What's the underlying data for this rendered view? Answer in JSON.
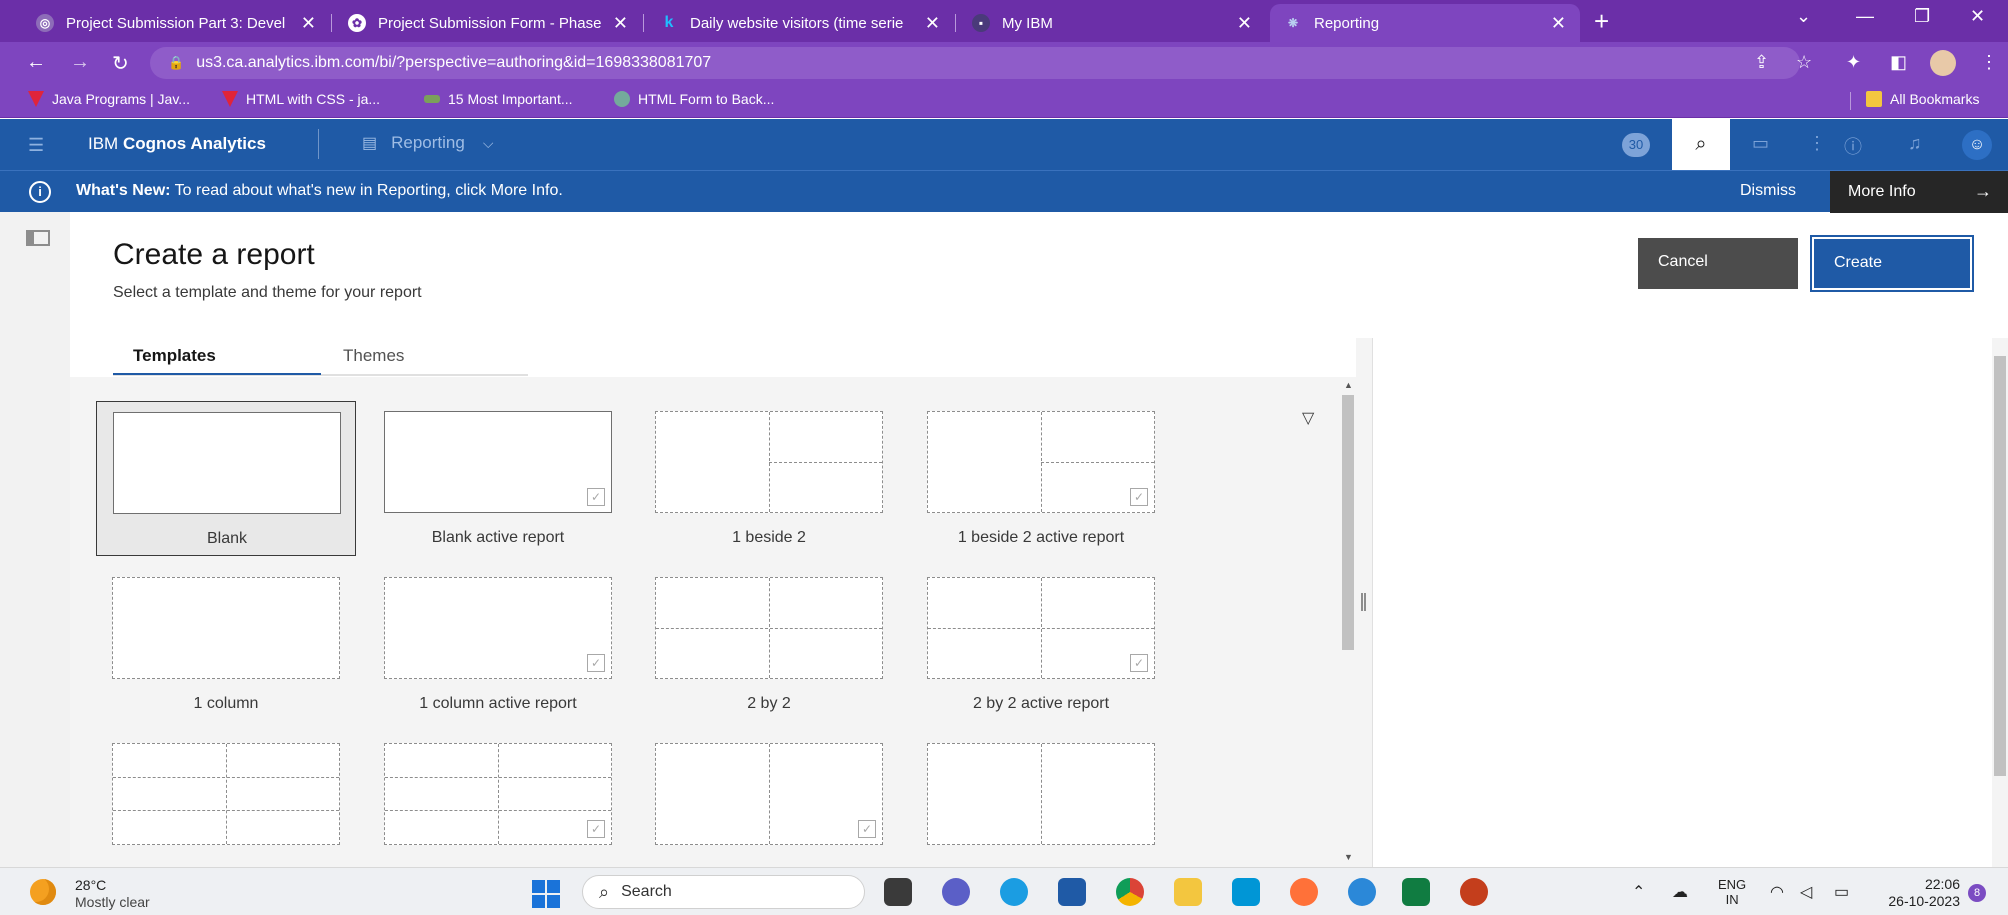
{
  "browser": {
    "tabs": [
      {
        "title": "Project Submission Part 3: Devel",
        "active": false
      },
      {
        "title": "Project Submission Form - Phase",
        "active": false
      },
      {
        "title": "Daily website visitors (time serie",
        "active": false
      },
      {
        "title": "My IBM",
        "active": false
      },
      {
        "title": "Reporting",
        "active": true
      }
    ],
    "url": "us3.ca.analytics.ibm.com/bi/?perspective=authoring&id=1698338081707",
    "bookmarks": [
      "Java Programs | Jav...",
      "HTML with CSS - ja...",
      "15 Most Important...",
      "HTML Form to Back..."
    ],
    "all_bookmarks": "All Bookmarks"
  },
  "app": {
    "brand_prefix": "IBM",
    "brand_name": "Cognos Analytics",
    "perspective": "Reporting",
    "notification_count": "30"
  },
  "whats_new": {
    "label": "What's New:",
    "message": "To read about what's new in Reporting, click More Info.",
    "dismiss": "Dismiss",
    "more_info": "More Info"
  },
  "page": {
    "title": "Create a report",
    "subtitle": "Select a template and theme for your report",
    "cancel": "Cancel",
    "create": "Create",
    "tabs": [
      "Templates",
      "Themes"
    ],
    "selected_tab": "Templates"
  },
  "templates": [
    {
      "label": "Blank",
      "layout": "blank",
      "active": false,
      "selected": true
    },
    {
      "label": "Blank active report",
      "layout": "blank",
      "active": true,
      "selected": false
    },
    {
      "label": "1 beside 2",
      "layout": "1beside2",
      "active": false,
      "selected": false
    },
    {
      "label": "1 beside 2 active report",
      "layout": "1beside2",
      "active": true,
      "selected": false
    },
    {
      "label": "1 column",
      "layout": "1column",
      "active": false,
      "selected": false
    },
    {
      "label": "1 column active report",
      "layout": "1column",
      "active": true,
      "selected": false
    },
    {
      "label": "2 by 2",
      "layout": "2by2",
      "active": false,
      "selected": false
    },
    {
      "label": "2 by 2 active report",
      "layout": "2by2",
      "active": true,
      "selected": false
    },
    {
      "label": "",
      "layout": "2by3",
      "active": false,
      "selected": false
    },
    {
      "label": "",
      "layout": "2by3",
      "active": true,
      "selected": false
    },
    {
      "label": "",
      "layout": "2col",
      "active": true,
      "selected": false
    },
    {
      "label": "",
      "layout": "2col",
      "active": false,
      "selected": false
    }
  ],
  "taskbar": {
    "temperature": "28°C",
    "weather": "Mostly clear",
    "search": "Search",
    "lang_top": "ENG",
    "lang_bottom": "IN",
    "time": "22:06",
    "date": "26-10-2023",
    "notifications": "8"
  },
  "colors": {
    "browser_purple": "#6b2fa8",
    "cognos_blue": "#1f5aa6",
    "cancel_gray": "#4c4c4c"
  }
}
